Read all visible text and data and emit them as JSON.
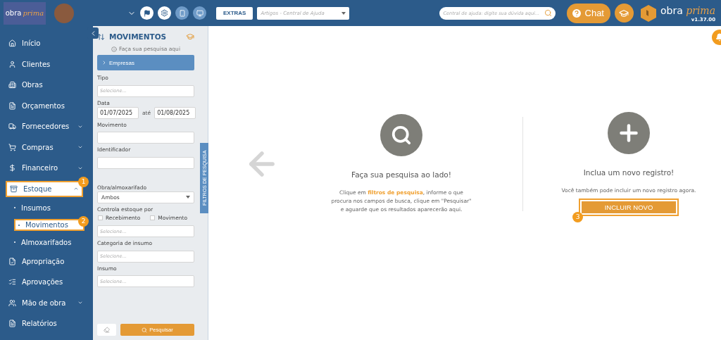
{
  "topbar": {
    "logo": {
      "word1": "obra",
      "word2": "prima"
    },
    "extras_button": "EXTRAS",
    "articles_select": {
      "placeholder": "Artigos - Central de Ajuda"
    },
    "help_search": {
      "placeholder": "Central de ajuda: digite sua dúvida aqui..."
    },
    "chat_button": "Chat",
    "brand": {
      "word1": "obra",
      "word2": "prima",
      "version": "v1.37.00"
    }
  },
  "sidebar": {
    "items": [
      {
        "label": "Início",
        "kind": "link"
      },
      {
        "label": "Clientes",
        "kind": "link"
      },
      {
        "label": "Obras",
        "kind": "link"
      },
      {
        "label": "Orçamentos",
        "kind": "link"
      },
      {
        "label": "Fornecedores",
        "kind": "group",
        "expanded": false
      },
      {
        "label": "Compras",
        "kind": "group",
        "expanded": false
      },
      {
        "label": "Financeiro",
        "kind": "group",
        "expanded": false
      },
      {
        "label": "Estoque",
        "kind": "group",
        "expanded": true,
        "callout": "1",
        "children": [
          {
            "label": "Insumos"
          },
          {
            "label": "Movimentos",
            "callout": "2"
          },
          {
            "label": "Almoxarifados"
          }
        ]
      },
      {
        "label": "Apropriação",
        "kind": "link"
      },
      {
        "label": "Aprovações",
        "kind": "link"
      },
      {
        "label": "Mão de obra",
        "kind": "group",
        "expanded": false
      },
      {
        "label": "Relatórios",
        "kind": "link"
      }
    ]
  },
  "filters": {
    "title": "MOVIMENTOS",
    "hint": "Faça sua pesquisa aqui",
    "section": "Empresas",
    "fields": [
      {
        "kind": "input",
        "label": "Tipo",
        "placeholder": "Selecione..."
      },
      {
        "kind": "daterange",
        "label": "Data",
        "from": "01/07/2025",
        "separator": "até",
        "to": "01/08/2025"
      },
      {
        "kind": "input",
        "label": "Movimento"
      },
      {
        "kind": "input",
        "label": "Identificador"
      },
      {
        "kind": "select",
        "label": "Obra/almoxarifado",
        "value": "Ambos"
      },
      {
        "kind": "checks",
        "label": "Controla estoque por",
        "options": [
          {
            "label": "Recebimento",
            "checked": false
          },
          {
            "label": "Movimento",
            "checked": false
          }
        ],
        "placeholder": "Selecione..."
      },
      {
        "kind": "input",
        "label": "Categoria de insumo",
        "placeholder": "Selecione..."
      },
      {
        "kind": "input",
        "label": "Insumo",
        "placeholder": "Selecione..."
      }
    ],
    "search_button": "Pesquisar",
    "side_tab": "FILTROS DE PESQUISA"
  },
  "main": {
    "search_panel": {
      "title": "Faça sua pesquisa ao lado!",
      "text": "Clique em **filtros de pesquisa**, informe o que procura nos campos de busca, clique em \"Pesquisar\" e aguarde que os resultados aparecerão aqui."
    },
    "new_panel": {
      "title": "Inclua um novo registro!",
      "text": "Você também pode incluir um novo registro agora.",
      "button": "INCLUIR NOVO",
      "callout": "3"
    }
  }
}
